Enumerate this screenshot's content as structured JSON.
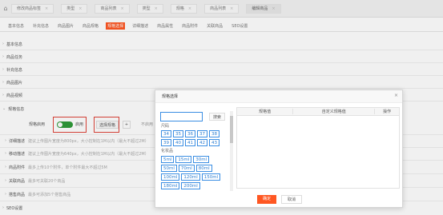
{
  "topbar": {
    "tabs": [
      {
        "label": "修改商品标签"
      },
      {
        "label": "类型"
      },
      {
        "label": "商品列表"
      },
      {
        "label": "类型"
      },
      {
        "label": "规格"
      },
      {
        "label": "商品列表"
      },
      {
        "label": "编辑商品"
      }
    ]
  },
  "subnav": {
    "items": [
      "基本信息",
      "补充信息",
      "商品图片",
      "商品规格",
      "规格选择",
      "详细描述",
      "商品属性",
      "商品附件",
      "关联商品",
      "SEO设置"
    ]
  },
  "sections": {
    "basic": "基本信息",
    "extra": "商品任务",
    "supp": "补充信息",
    "images": "商品图片",
    "video": "商品视频",
    "spec": "规格信息",
    "desc": "详细描述",
    "mobile_desc": "移动描述",
    "attach": "商品附件",
    "related": "关联商品",
    "promo": "搭售商品",
    "seo": "SEO设置"
  },
  "rows": {
    "desc_hint": "建议上传图片宽度为800px，大小控制在1M以内（最大不超过2M）",
    "mobile_hint": "建议上传图片宽度为640px，大小控制在1M以内（最大不超过2M）",
    "attach_hint": "最多上传10个附件，单个附件最大不超过5M",
    "related_hint": "最多可关联20个商品",
    "promo_hint": "最多可添加5个搭售商品"
  },
  "spec_row": {
    "field_label": "规格启用",
    "toggle_label": "启用",
    "spec_button": "选择规格",
    "add_button": "+",
    "unbind_text": "不启用"
  },
  "modal": {
    "title": "规格选择",
    "search_placeholder": "",
    "search_button": "搜索",
    "groups": [
      {
        "title": "尺码",
        "options": [
          "34",
          "35",
          "36",
          "37",
          "38",
          "39",
          "40",
          "41",
          "42",
          "43"
        ]
      },
      {
        "title": "化妆品",
        "options": [
          "5ml",
          "15ml",
          "30ml",
          "50ml",
          "70ml",
          "80ml",
          "100ml",
          "120ml",
          "150ml",
          "180ml",
          "200ml"
        ]
      }
    ],
    "table_headers": [
      "规格值",
      "自定义规格值",
      "操作"
    ],
    "ok_button": "确定",
    "cancel_button": "取消"
  }
}
